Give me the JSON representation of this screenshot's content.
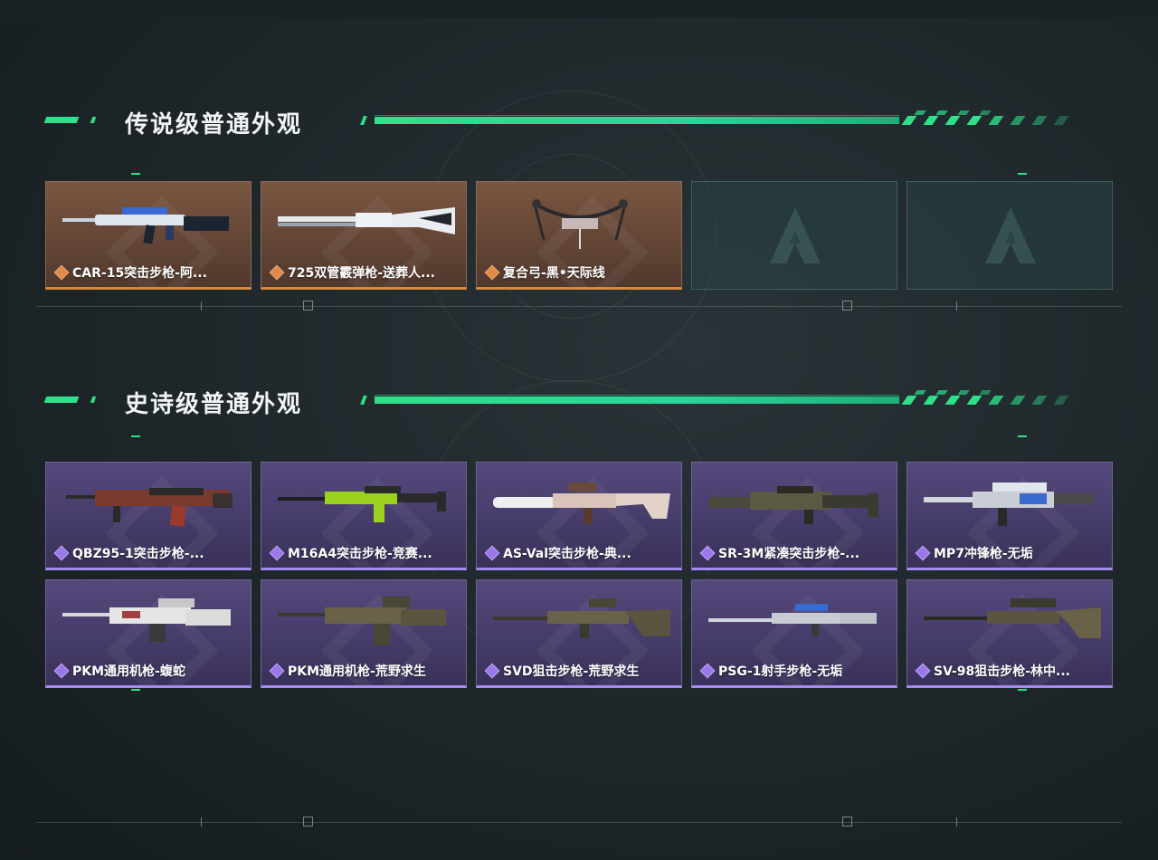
{
  "sections": [
    {
      "title": "传说级普通外观",
      "items": [
        {
          "name": "CAR-15突击步枪-阿...",
          "icon": "rifle-icon",
          "filled": true
        },
        {
          "name": "725双管霰弹枪-送葬人...",
          "icon": "shotgun-icon",
          "filled": true
        },
        {
          "name": "复合弓-黑•天际线",
          "icon": "bow-icon",
          "filled": true
        },
        {
          "name": "",
          "icon": "placeholder-logo-icon",
          "filled": false
        },
        {
          "name": "",
          "icon": "placeholder-logo-icon",
          "filled": false
        }
      ]
    },
    {
      "title": "史诗级普通外观",
      "items": [
        {
          "name": "QBZ95-1突击步枪-...",
          "icon": "rifle-icon",
          "filled": true
        },
        {
          "name": "M16A4突击步枪-竞赛...",
          "icon": "rifle-icon",
          "filled": true
        },
        {
          "name": "AS-Val突击步枪-典...",
          "icon": "rifle-icon",
          "filled": true
        },
        {
          "name": "SR-3M紧凑突击步枪-...",
          "icon": "rifle-icon",
          "filled": true
        },
        {
          "name": "MP7冲锋枪-无垢",
          "icon": "smg-icon",
          "filled": true
        },
        {
          "name": "PKM通用机枪-蝮蛇",
          "icon": "machine-gun-icon",
          "filled": true
        },
        {
          "name": "PKM通用机枪-荒野求生",
          "icon": "machine-gun-icon",
          "filled": true
        },
        {
          "name": "SVD狙击步枪-荒野求生",
          "icon": "sniper-rifle-icon",
          "filled": true
        },
        {
          "name": "PSG-1射手步枪-无垢",
          "icon": "marksman-rifle-icon",
          "filled": true
        },
        {
          "name": "SV-98狙击步枪-林中...",
          "icon": "sniper-rifle-icon",
          "filled": true
        }
      ]
    }
  ],
  "colors": {
    "accent": "#2ee08a",
    "legendary": "#d88a3c",
    "epic": "#a58af0",
    "background": "#1d2629"
  }
}
